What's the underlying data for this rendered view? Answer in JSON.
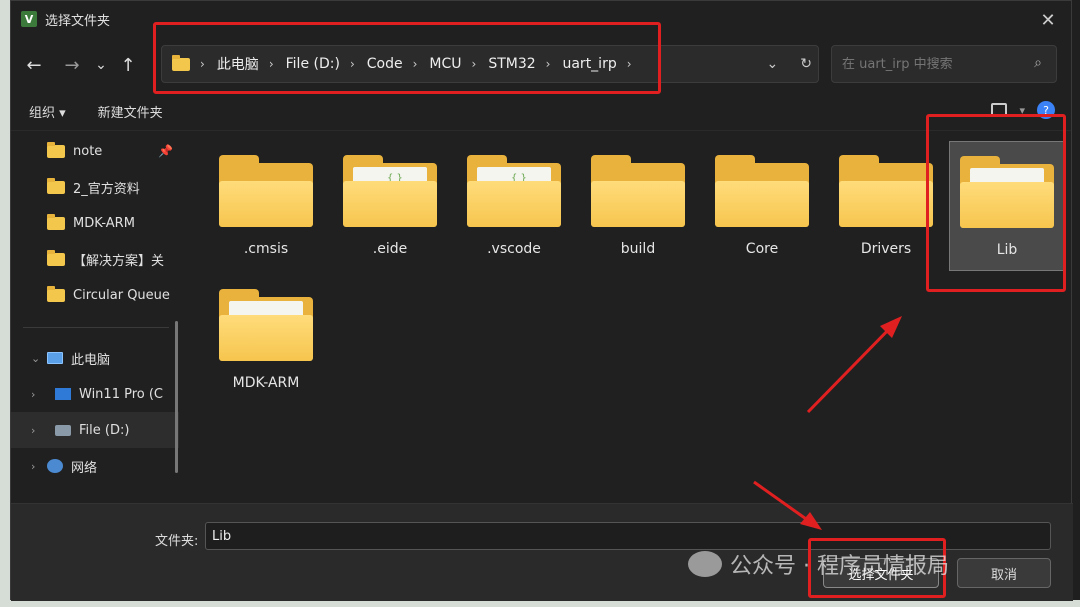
{
  "window": {
    "title": "选择文件夹",
    "app_icon": "V"
  },
  "nav": {
    "back": "←",
    "forward": "→",
    "recent": "⌄",
    "up": "↑",
    "breadcrumbs": [
      "此电脑",
      "File (D:)",
      "Code",
      "MCU",
      "STM32",
      "uart_irp"
    ],
    "search_placeholder": "在 uart_irp 中搜索"
  },
  "toolbar": {
    "organize": "组织 ▾",
    "new_folder": "新建文件夹"
  },
  "sidebar": {
    "quick": [
      {
        "label": "note",
        "pinned": true
      },
      {
        "label": "2_官方资料"
      },
      {
        "label": "MDK-ARM"
      },
      {
        "label": "【解决方案】关"
      },
      {
        "label": "Circular Queue"
      }
    ],
    "pc": {
      "label": "此电脑"
    },
    "drives": [
      {
        "label": "Win11 Pro (C"
      },
      {
        "label": "File (D:)"
      }
    ],
    "network": {
      "label": "网络"
    }
  },
  "folders": [
    {
      "name": ".cmsis",
      "variant": "plain"
    },
    {
      "name": ".eide",
      "variant": "code"
    },
    {
      "name": ".vscode",
      "variant": "code"
    },
    {
      "name": "build",
      "variant": "plain"
    },
    {
      "name": "Core",
      "variant": "plain"
    },
    {
      "name": "Drivers",
      "variant": "plain"
    },
    {
      "name": "Lib",
      "variant": "blue",
      "selected": true
    },
    {
      "name": "MDK-ARM",
      "variant": "paper"
    }
  ],
  "footer": {
    "folder_label": "文件夹:",
    "folder_value": "Lib",
    "select_button": "选择文件夹",
    "cancel_button": "取消"
  },
  "watermark": {
    "text": "公众号 · 程序员情报局"
  },
  "colors": {
    "annotation": "#e02020",
    "folder": "#f6c54e",
    "accent": "#3b82f6"
  }
}
